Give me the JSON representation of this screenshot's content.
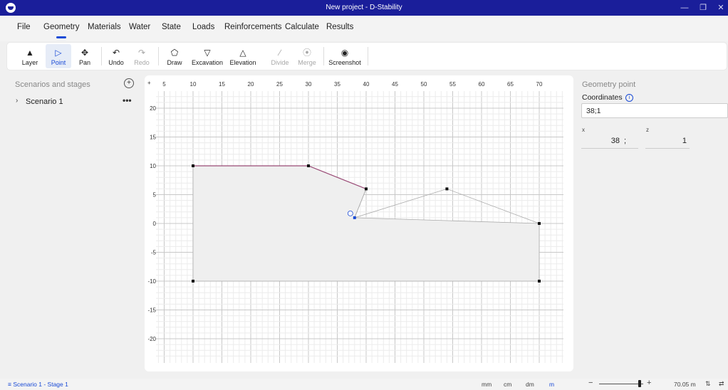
{
  "window": {
    "title": "New project - D-Stability"
  },
  "menu": [
    "File",
    "Geometry",
    "Materials",
    "Water",
    "State",
    "Loads",
    "Reinforcements",
    "Calculate",
    "Results"
  ],
  "toolbar": {
    "layer": "Layer",
    "point": "Point",
    "pan": "Pan",
    "undo": "Undo",
    "redo": "Redo",
    "draw": "Draw",
    "excavation": "Excavation",
    "elevation": "Elevation",
    "divide": "Divide",
    "merge": "Merge",
    "screenshot": "Screenshot"
  },
  "left_panel": {
    "title": "Scenarios and stages",
    "scenario": "Scenario 1",
    "more": "•••"
  },
  "canvas": {
    "corner_plus": "+",
    "x_ticks": [
      5,
      10,
      15,
      20,
      25,
      30,
      35,
      40,
      45,
      50,
      55,
      60,
      65,
      70
    ],
    "y_ticks": [
      20,
      15,
      10,
      5,
      0,
      -5,
      -10,
      -15,
      -20
    ],
    "layer1": [
      [
        10,
        10
      ],
      [
        30,
        10
      ],
      [
        40,
        6
      ],
      [
        38,
        1
      ],
      [
        70,
        0
      ],
      [
        70,
        -10
      ],
      [
        10,
        -10
      ]
    ],
    "layer2": [
      [
        40,
        6
      ],
      [
        38,
        1
      ],
      [
        54,
        6
      ],
      [
        70,
        0
      ]
    ],
    "points": [
      [
        10,
        10
      ],
      [
        30,
        10
      ],
      [
        40,
        6
      ],
      [
        54,
        6
      ],
      [
        70,
        0
      ],
      [
        10,
        -10
      ],
      [
        70,
        -10
      ]
    ],
    "selected_point": [
      38,
      1
    ],
    "colors": {
      "boundary": "#9a4a76",
      "line": "#aaaaaa",
      "fill": "#efefef",
      "selected": "#1a4bd6"
    }
  },
  "right_panel": {
    "title": "Geometry point",
    "coordinates_label": "Coordinates",
    "coordinates_value": "38;1",
    "x_label": "x",
    "z_label": "z",
    "x_value": "38",
    "z_value": "1",
    "separator": ";"
  },
  "status": {
    "stage": "Scenario 1 - Stage 1",
    "units": [
      "mm",
      "cm",
      "dm",
      "m"
    ],
    "active_unit": "m",
    "zoom_level": 0.92,
    "zoom_value": "70.05 m"
  }
}
